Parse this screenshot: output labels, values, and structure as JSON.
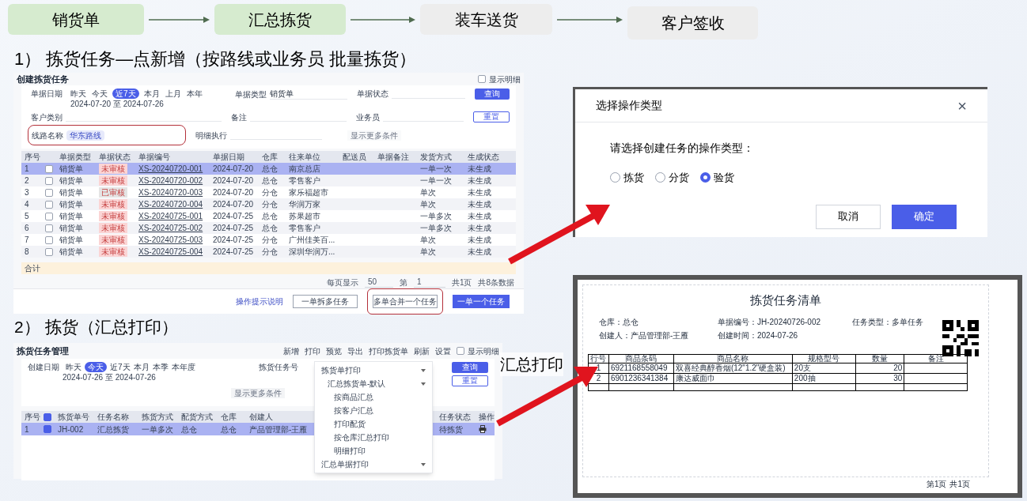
{
  "flow": [
    {
      "label": "销货单",
      "active": true
    },
    {
      "label": "汇总拣货",
      "active": true
    },
    {
      "label": "装车送货",
      "active": false
    },
    {
      "label": "客户签收",
      "active": false
    }
  ],
  "section_1": {
    "heading": "1） 拣货任务—点新增（按路线或业务员 批量拣货）"
  },
  "create_task": {
    "title": "创建拣货任务",
    "show_detail": {
      "label": "显示明细",
      "checked": false
    },
    "date_label": "单据日期",
    "date_ranges": [
      {
        "label": "昨天",
        "selected": false
      },
      {
        "label": "今天",
        "selected": false
      },
      {
        "label": "近7天",
        "selected": true
      },
      {
        "label": "本月",
        "selected": false
      },
      {
        "label": "上月",
        "selected": false
      },
      {
        "label": "本年",
        "selected": false
      }
    ],
    "date_value": "2024-07-20 至 2024-07-26",
    "doc_type": {
      "label": "单据类型",
      "value": "销货单"
    },
    "doc_status": {
      "label": "单据状态"
    },
    "customer_type": {
      "label": "客户类别"
    },
    "remark": {
      "label": "备注"
    },
    "salesman": {
      "label": "业务员"
    },
    "route": {
      "label": "线路名称",
      "tag": "华东路线",
      "highlighted": true
    },
    "detail": {
      "label": "明细执行"
    },
    "query_button": "查询",
    "reset_button": "重置",
    "more_link": "显示更多条件",
    "columns": [
      "序号",
      "",
      "单据类型",
      "单据状态",
      "单据编号",
      "单据日期",
      "仓库",
      "往来单位",
      "配送员",
      "单据备注",
      "发货方式",
      "生成状态"
    ],
    "rows": [
      {
        "cells": [
          "1",
          "",
          "销货单",
          "未审核",
          "XS-20240720-001",
          "2024-07-20",
          "总仓",
          "南京总店",
          "",
          "",
          "一单一次",
          "未生成"
        ],
        "color": "#fbd5d5",
        "checked": false,
        "selected": true
      },
      {
        "cells": [
          "2",
          "",
          "销货单",
          "未审核",
          "XS-20240720-002",
          "2024-07-20",
          "总仓",
          "零售客户",
          "",
          "",
          "一单一次",
          "未生成"
        ],
        "color": "#fbd5d5",
        "checked": false,
        "selected": false
      },
      {
        "cells": [
          "3",
          "",
          "销货单",
          "已审核",
          "XS-20240720-003",
          "2024-07-20",
          "分仓",
          "家乐福超市",
          "",
          "",
          "单次",
          "未生成"
        ],
        "color": "#e4e4e4",
        "checked": false,
        "selected": false
      },
      {
        "cells": [
          "4",
          "",
          "销货单",
          "未审核",
          "XS-20240720-004",
          "2024-07-20",
          "分仓",
          "华润万家",
          "",
          "",
          "单次",
          "未生成"
        ],
        "color": "#fbd5d5",
        "checked": false,
        "selected": false
      },
      {
        "cells": [
          "5",
          "",
          "销货单",
          "未审核",
          "XS-20240725-001",
          "2024-07-25",
          "总仓",
          "苏果超市",
          "",
          "",
          "一单多次",
          "未生成"
        ],
        "color": "#fbd5d5",
        "checked": false,
        "selected": false
      },
      {
        "cells": [
          "6",
          "",
          "销货单",
          "未审核",
          "XS-20240725-002",
          "2024-07-25",
          "总仓",
          "零售客户",
          "",
          "",
          "一单多次",
          "未生成"
        ],
        "color": "#fbd5d5",
        "checked": false,
        "selected": false
      },
      {
        "cells": [
          "7",
          "",
          "销货单",
          "未审核",
          "XS-20240725-003",
          "2024-07-25",
          "分仓",
          "广州佳美百...",
          "",
          "",
          "单次",
          "未生成"
        ],
        "color": "#fbd5d5",
        "checked": false,
        "selected": false
      },
      {
        "cells": [
          "8",
          "",
          "销货单",
          "未审核",
          "XS-20240725-004",
          "2024-07-25",
          "分仓",
          "深圳华润万...",
          "",
          "",
          "单次",
          "未生成"
        ],
        "color": "#fbd5d5",
        "checked": false,
        "selected": false
      }
    ],
    "total_label": "合计",
    "pagination": {
      "page_size_label": "每页显示",
      "page_size": "50",
      "page_label": "第",
      "page": "1",
      "pages": "共1页",
      "count": "共8条数据"
    },
    "help_link": "操作提示说明",
    "buttons": [
      {
        "label": "一单拆多任务",
        "kind": "default",
        "highlighted": false
      },
      {
        "label": "多单合并一个任务",
        "kind": "default",
        "highlighted": true
      },
      {
        "label": "一单一个任务",
        "kind": "primary",
        "highlighted": false
      }
    ]
  },
  "type_dialog": {
    "title": "选择操作类型",
    "close": "×",
    "prompt": "请选择创建任务的操作类型：",
    "options": [
      {
        "label": "拣货",
        "selected": false
      },
      {
        "label": "分货",
        "selected": false
      },
      {
        "label": "验货",
        "selected": true
      }
    ],
    "cancel": "取消",
    "confirm": "确定"
  },
  "section_2": {
    "heading": "2） 拣货（汇总打印）"
  },
  "task_manage": {
    "title": "拣货任务管理",
    "toolbar": [
      "新增",
      "打印",
      "预览",
      "导出",
      "打印拣货单",
      "刷新",
      "设置"
    ],
    "show_detail": {
      "label": "显示明细",
      "checked": false
    },
    "date_label": "创建日期",
    "date_ranges": [
      {
        "label": "昨天",
        "selected": false
      },
      {
        "label": "今天",
        "selected": true
      },
      {
        "label": "近7天",
        "selected": false
      },
      {
        "label": "本月",
        "selected": false
      },
      {
        "label": "本季",
        "selected": false
      },
      {
        "label": "本年度",
        "selected": false
      }
    ],
    "date_value": "2024-07-26 至 2024-07-26",
    "filter_label": "拣货任务号",
    "query_button": "查询",
    "reset_button": "重置",
    "more_link": "显示更多条件",
    "columns": [
      "序号",
      "",
      "拣货单号",
      "任务名称",
      "拣货方式",
      "配货方式",
      "仓库",
      "创建人",
      "任务状态",
      "操作"
    ],
    "header_checked": true,
    "rows": [
      {
        "cells": [
          "1",
          "",
          "JH-002",
          "汇总拣货",
          "一单多次",
          "总仓",
          "总仓",
          "产品管理部-王雁",
          "待拣货"
        ],
        "checked": true,
        "selected": true
      }
    ],
    "menu": {
      "items": [
        {
          "label": "拣货单打印",
          "kind": "group"
        },
        {
          "label": "汇总拣货单-默认",
          "kind": "choice"
        },
        {
          "label": "按商品汇总",
          "kind": "item"
        },
        {
          "label": "按客户汇总",
          "kind": "item"
        },
        {
          "label": "打印配货",
          "kind": "item"
        },
        {
          "label": "按仓库汇总打印",
          "kind": "item"
        },
        {
          "label": "明细打印",
          "kind": "item"
        },
        {
          "label": "汇总单据打印",
          "kind": "group"
        }
      ]
    }
  },
  "print_label": "汇总打印",
  "print_preview": {
    "title": "拣货任务清单",
    "fields": [
      {
        "label": "仓库：",
        "value": "总仓"
      },
      {
        "label": "单据编号：",
        "value": "JH-20240726-002"
      },
      {
        "label": "任务类型：",
        "value": "多单任务"
      },
      {
        "label": "创建人：",
        "value": "产品管理部-王雁"
      },
      {
        "label": "创建时间：",
        "value": "2024-07-26"
      }
    ],
    "columns": [
      "行号",
      "商品条码",
      "商品名称",
      "规格型号",
      "数量",
      "备注"
    ],
    "rows": [
      [
        "1",
        "6921168558049",
        "双喜经典醇香烟(12\"1.2\"硬盒装)",
        "20支",
        "20",
        ""
      ],
      [
        "2",
        "6901236341384",
        "康达威面巾",
        "200抽",
        "30",
        ""
      ]
    ],
    "page": "第1页",
    "total_pages": "共1页"
  }
}
